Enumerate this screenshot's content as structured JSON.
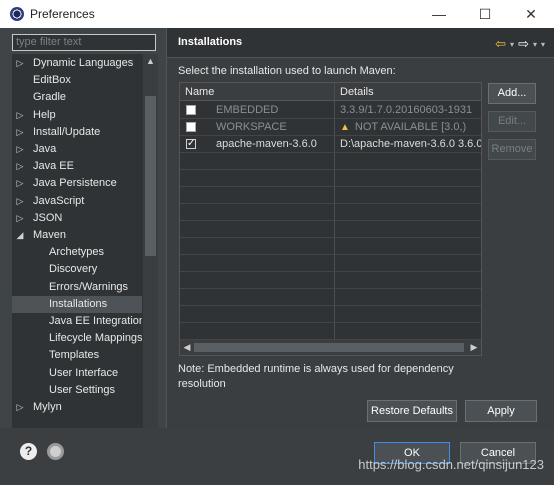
{
  "window": {
    "title": "Preferences",
    "controls": {
      "minimize": "—",
      "maximize": "☐",
      "close": "✕"
    }
  },
  "filter": {
    "placeholder": "type filter text"
  },
  "tree": {
    "items": [
      {
        "label": "Dynamic Languages",
        "arrow": "▷",
        "indent": 0,
        "selected": false
      },
      {
        "label": "EditBox",
        "arrow": "",
        "indent": 0,
        "selected": false
      },
      {
        "label": "Gradle",
        "arrow": "",
        "indent": 0,
        "selected": false
      },
      {
        "label": "Help",
        "arrow": "▷",
        "indent": 0,
        "selected": false
      },
      {
        "label": "Install/Update",
        "arrow": "▷",
        "indent": 0,
        "selected": false
      },
      {
        "label": "Java",
        "arrow": "▷",
        "indent": 0,
        "selected": false
      },
      {
        "label": "Java EE",
        "arrow": "▷",
        "indent": 0,
        "selected": false
      },
      {
        "label": "Java Persistence",
        "arrow": "▷",
        "indent": 0,
        "selected": false
      },
      {
        "label": "JavaScript",
        "arrow": "▷",
        "indent": 0,
        "selected": false
      },
      {
        "label": "JSON",
        "arrow": "▷",
        "indent": 0,
        "selected": false
      },
      {
        "label": "Maven",
        "arrow": "◢",
        "indent": 0,
        "selected": false
      },
      {
        "label": "Archetypes",
        "arrow": "",
        "indent": 1,
        "selected": false
      },
      {
        "label": "Discovery",
        "arrow": "",
        "indent": 1,
        "selected": false
      },
      {
        "label": "Errors/Warnings",
        "arrow": "",
        "indent": 1,
        "selected": false
      },
      {
        "label": "Installations",
        "arrow": "",
        "indent": 1,
        "selected": true
      },
      {
        "label": "Java EE Integration",
        "arrow": "",
        "indent": 1,
        "selected": false
      },
      {
        "label": "Lifecycle Mappings",
        "arrow": "",
        "indent": 1,
        "selected": false
      },
      {
        "label": "Templates",
        "arrow": "",
        "indent": 1,
        "selected": false
      },
      {
        "label": "User Interface",
        "arrow": "",
        "indent": 1,
        "selected": false
      },
      {
        "label": "User Settings",
        "arrow": "",
        "indent": 1,
        "selected": false
      },
      {
        "label": "Mylyn",
        "arrow": "▷",
        "indent": 0,
        "selected": false
      }
    ]
  },
  "panel": {
    "title": "Installations",
    "instruction": "Select the installation used to launch Maven:",
    "columns": {
      "name": "Name",
      "details": "Details"
    },
    "rows": [
      {
        "name": "EMBEDDED",
        "details": "3.3.9/1.7.0.20160603-1931",
        "checked": false,
        "muted": true,
        "warning": false
      },
      {
        "name": "WORKSPACE",
        "details": "NOT AVAILABLE [3.0,)",
        "checked": false,
        "muted": true,
        "warning": true
      },
      {
        "name": "apache-maven-3.6.0",
        "details": "D:\\apache-maven-3.6.0 3.6.0",
        "checked": true,
        "muted": false,
        "warning": false
      }
    ],
    "buttons": {
      "add": "Add...",
      "edit": "Edit...",
      "remove": "Remove"
    },
    "note": "Note: Embedded runtime is always used for dependency resolution",
    "restore_defaults": "Restore Defaults",
    "apply": "Apply"
  },
  "footer": {
    "ok": "OK",
    "cancel": "Cancel",
    "help_glyph": "?",
    "watermark": "https://blog.csdn.net/qinsijun123"
  },
  "icons": {
    "back": "⇦",
    "forward": "⇨",
    "menu_caret": "▾",
    "check": "✓",
    "warn": "▲",
    "scroll_up": "▲",
    "scroll_down": "▼",
    "scroll_left": "◀",
    "scroll_right": "▶"
  }
}
